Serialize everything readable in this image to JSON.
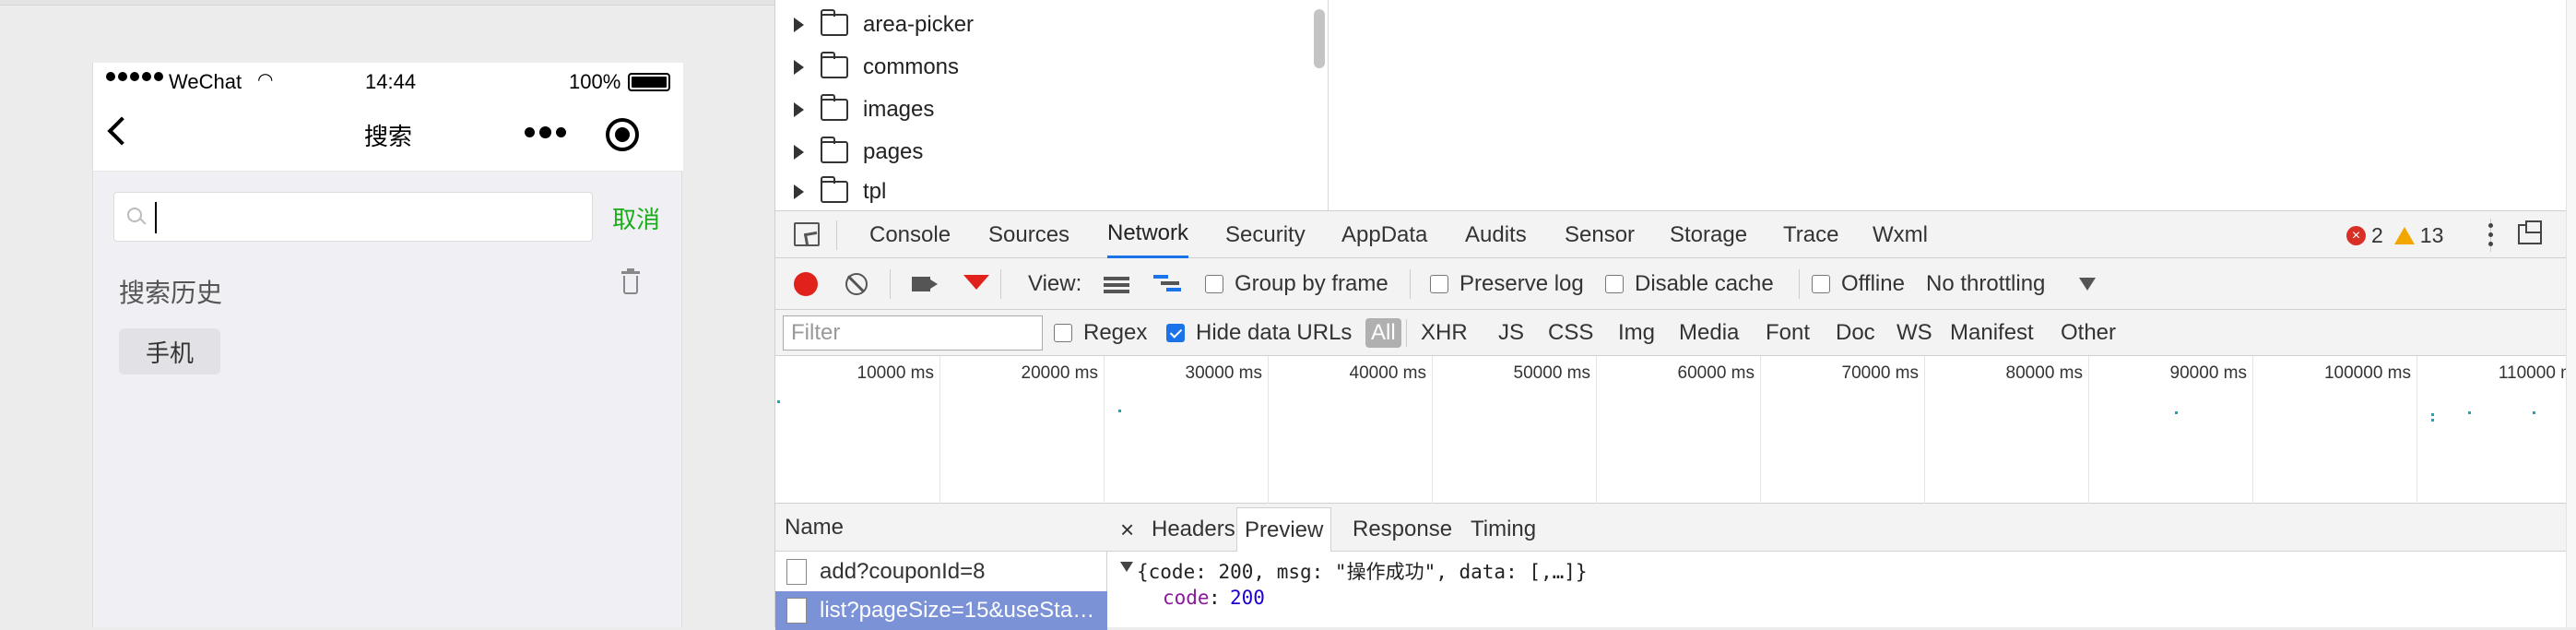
{
  "simulator": {
    "status": {
      "carrier": "WeChat",
      "time": "14:44",
      "battery": "100%"
    },
    "nav": {
      "title": "搜索"
    },
    "search": {
      "value": "",
      "cancel": "取消"
    },
    "history": {
      "label": "搜索历史",
      "tags": [
        "手机"
      ]
    }
  },
  "devtools": {
    "tree": [
      "area-picker",
      "commons",
      "images",
      "pages",
      "tpl"
    ],
    "tabs": [
      "Console",
      "Sources",
      "Network",
      "Security",
      "AppData",
      "Audits",
      "Sensor",
      "Storage",
      "Trace",
      "Wxml"
    ],
    "active_tab": "Network",
    "errors": "2",
    "warnings": "13",
    "toolbar": {
      "view_label": "View:",
      "group_by_frame": "Group by frame",
      "preserve_log": "Preserve log",
      "disable_cache": "Disable cache",
      "offline": "Offline",
      "throttling": "No throttling"
    },
    "filter": {
      "placeholder": "Filter",
      "regex": "Regex",
      "hide_data_urls": "Hide data URLs",
      "types": [
        "All",
        "XHR",
        "JS",
        "CSS",
        "Img",
        "Media",
        "Font",
        "Doc",
        "WS",
        "Manifest",
        "Other"
      ]
    },
    "timeline": {
      "ticks": [
        "10000 ms",
        "20000 ms",
        "30000 ms",
        "40000 ms",
        "50000 ms",
        "60000 ms",
        "70000 ms",
        "80000 ms",
        "90000 ms",
        "100000 ms",
        "110000 m"
      ]
    },
    "requests": {
      "header": "Name",
      "rows": [
        "add?couponId=8",
        "list?pageSize=15&useSta…"
      ]
    },
    "detail": {
      "close": "×",
      "tabs": [
        "Headers",
        "Preview",
        "Response",
        "Timing"
      ],
      "active_tab": "Preview",
      "preview_line1": "{code: 200, msg: \"操作成功\", data: [,…]}",
      "code_key": "code",
      "code_value": "200"
    }
  },
  "colors": {
    "accent_green": "#1aad19",
    "selected_row": "#7b93d6",
    "tab_underline": "#1a73e8",
    "record_red": "#e0211c"
  }
}
